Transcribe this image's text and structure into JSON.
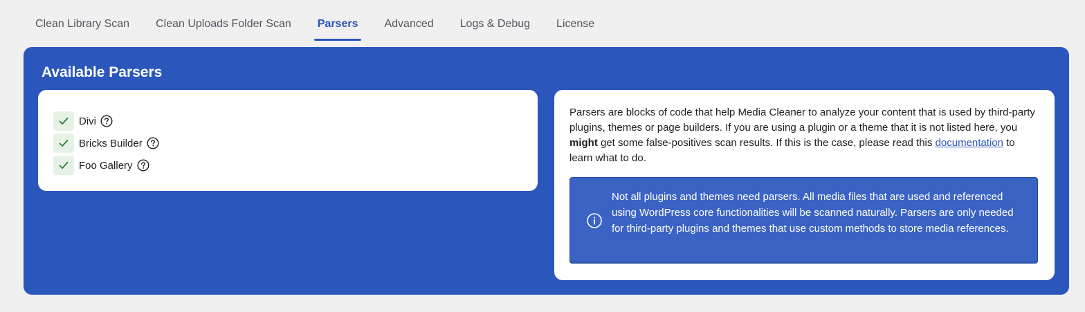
{
  "tabs": [
    {
      "label": "Clean Library Scan",
      "active": false
    },
    {
      "label": "Clean Uploads Folder Scan",
      "active": false
    },
    {
      "label": "Parsers",
      "active": true
    },
    {
      "label": "Advanced",
      "active": false
    },
    {
      "label": "Logs & Debug",
      "active": false
    },
    {
      "label": "License",
      "active": false
    }
  ],
  "panel": {
    "title": "Available Parsers",
    "parsers": [
      {
        "name": "Divi",
        "enabled": true
      },
      {
        "name": "Bricks Builder",
        "enabled": true
      },
      {
        "name": "Foo Gallery",
        "enabled": true
      }
    ],
    "description": {
      "part1": "Parsers are blocks of code that help Media Cleaner to analyze your content that is used by third-party plugins, themes or page builders. If you are using a plugin or a theme that it is not listed here, you ",
      "emphasis": "might",
      "part2": " get some false-positives scan results. If this is the case, please read this ",
      "link_text": "documentation",
      "part3": " to learn what to do."
    },
    "notice": {
      "icon": "info-icon",
      "text": "Not all plugins and themes need parsers. All media files that are used and referenced using WordPress core functionalities will be scanned naturally. Parsers are only needed for third-party plugins and themes that use custom methods to store media references."
    }
  },
  "colors": {
    "accent": "#2b55b8",
    "panel_bg": "#2b57bc",
    "notice_bg": "#3a63c4",
    "check": "#2e7d32",
    "check_bg": "#e6f2e6",
    "page_bg": "#f0f0f1"
  }
}
